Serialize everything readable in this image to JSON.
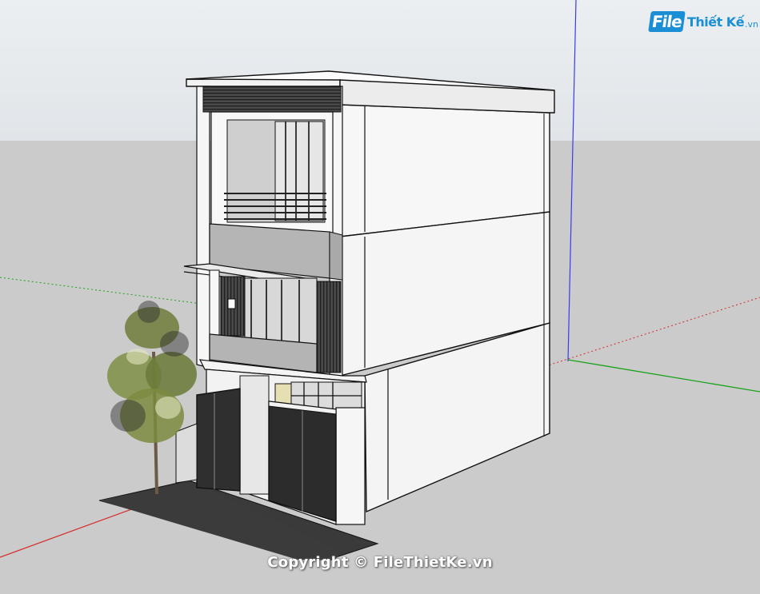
{
  "watermark": {
    "logo_file": "File",
    "logo_rest": "Thiết Kế",
    "logo_tld": ".vn",
    "copyright": "Copyright © FileThietKe.vn"
  },
  "colors": {
    "sky": "#e9ecef",
    "ground": "#cbcbcb",
    "wall": "#f7f7f7",
    "gray_panel": "#b4b4b4",
    "dark_slat": "#3c3c3c",
    "road": "#3b3b3b",
    "glass": "#d5d5d5",
    "accent": "#1a8fd6"
  },
  "icons": {
    "logo": "filethietke-logo-icon"
  }
}
